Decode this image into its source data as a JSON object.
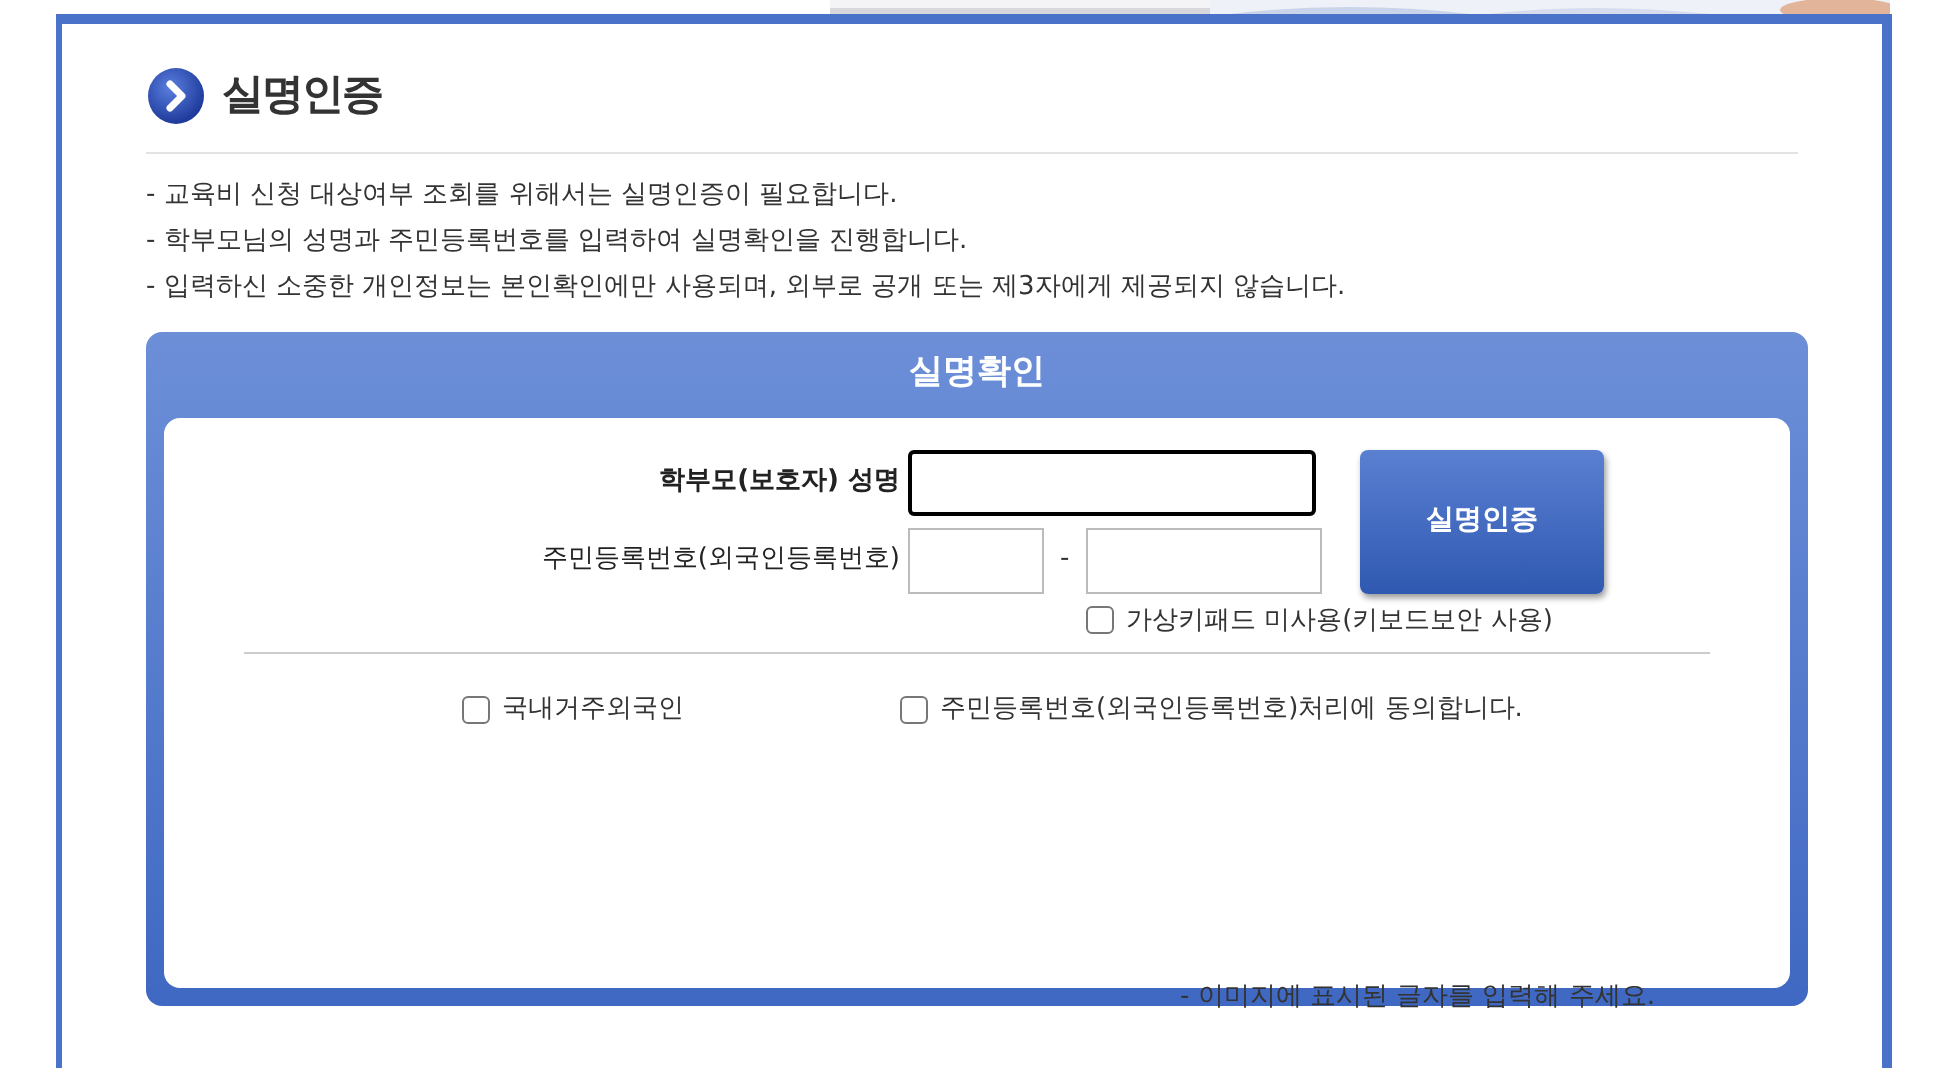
{
  "page_title": "실명인증",
  "notices": [
    "- 교육비 신청 대상여부 조회를 위해서는 실명인증이 필요합니다.",
    "- 학부모님의 성명과 주민등록번호를 입력하여 실명확인을 진행합니다.",
    "- 입력하신 소중한 개인정보는 본인확인에만 사용되며, 외부로 공개 또는 제3자에게 제공되지 않습니다."
  ],
  "panel": {
    "title": "실명확인",
    "fields": [
      {
        "kind": "single",
        "label": "학부모(보호자) 성명"
      },
      {
        "kind": "split",
        "label": "주민등록번호(외국인등록번호)",
        "separator": "-"
      }
    ],
    "submit_button": "실명인증",
    "keypad_option": {
      "label": "가상키패드 미사용(키보드보안 사용)",
      "checked": false
    },
    "options": [
      {
        "label": "국내거주외국인",
        "checked": false
      },
      {
        "label": "주민등록번호(외국인등록번호)처리에 동의합니다.",
        "checked": false
      }
    ],
    "footer_note": "- 이미지에 표시된 글자를 입력해 주세요."
  }
}
